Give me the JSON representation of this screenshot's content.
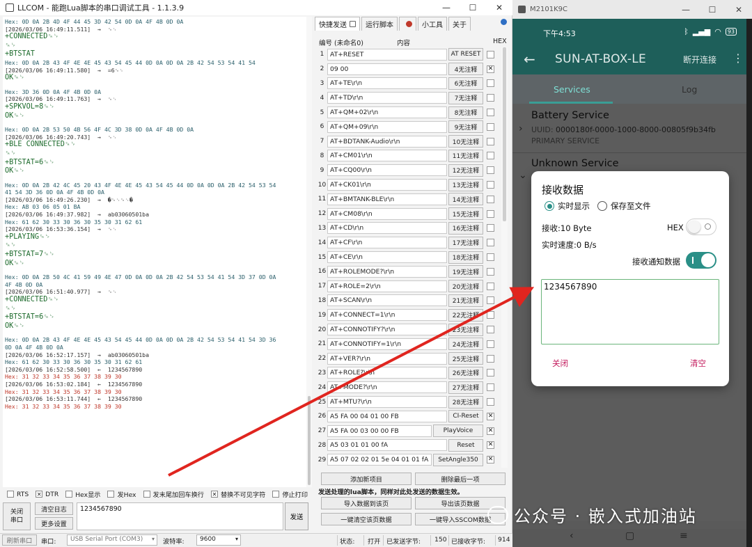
{
  "llcom": {
    "title": "LLCOM - 能跑Lua脚本的串口调试工具 - 1.1.3.9",
    "window_controls": {
      "minimize": "—",
      "maximize": "☐",
      "close": "✕"
    },
    "log": [
      {
        "k": "hex",
        "t": "Hex: 0D 0A 2B 4D 4F 44 45 3D 42 54 0D 0A 4F 4B 0D 0A"
      },
      {
        "k": "ts",
        "t": "[2026/03/06 16:49:11.511]  →  ␍␊"
      },
      {
        "k": "rx",
        "t": "+CONNECTED␍␊"
      },
      {
        "k": "rx",
        "t": "␍␊"
      },
      {
        "k": "rx",
        "t": "+BTSTAT"
      },
      {
        "k": "hex",
        "t": "Hex: 0D 0A 2B 43 4F 4E 4E 45 43 54 45 44 0D 0A 0D 0A 2B 42 54 53 54 41 54"
      },
      {
        "k": "ts",
        "t": "[2026/03/06 16:49:11.580]  →  =6␍␊"
      },
      {
        "k": "rx",
        "t": "OK␍␊"
      },
      {
        "k": "blank",
        "t": ""
      },
      {
        "k": "hex",
        "t": "Hex: 3D 36 0D 0A 4F 4B 0D 0A"
      },
      {
        "k": "ts",
        "t": "[2026/03/06 16:49:11.763]  →  ␍␊"
      },
      {
        "k": "rx",
        "t": "+SPKVOL=8␍␊"
      },
      {
        "k": "rx",
        "t": "OK␍␊"
      },
      {
        "k": "blank",
        "t": ""
      },
      {
        "k": "hex",
        "t": "Hex: 0D 0A 2B 53 50 4B 56 4F 4C 3D 38 0D 0A 4F 4B 0D 0A"
      },
      {
        "k": "ts",
        "t": "[2026/03/06 16:49:20.743]  →  ␍␊"
      },
      {
        "k": "rx",
        "t": "+BLE CONNECTED␍␊"
      },
      {
        "k": "rx",
        "t": "␍␊"
      },
      {
        "k": "rx",
        "t": "+BTSTAT=6␍␊"
      },
      {
        "k": "rx",
        "t": "OK␍␊"
      },
      {
        "k": "blank",
        "t": ""
      },
      {
        "k": "hex",
        "t": "Hex: 0D 0A 2B 42 4C 45 20 43 4F 4E 4E 45 43 54 45 44 0D 0A 0D 0A 2B 42 54 53 54"
      },
      {
        "k": "hex",
        "t": "41 54 3D 36 0D 0A 4F 4B 0D 0A"
      },
      {
        "k": "ts",
        "t": "[2026/03/06 16:49:26.230]  →  �␍␊␍␊�"
      },
      {
        "k": "hex",
        "t": "Hex: AB 03 06 05 01 BA"
      },
      {
        "k": "ts",
        "t": "[2026/03/06 16:49:37.982]  →  ab03060501ba"
      },
      {
        "k": "hex",
        "t": "Hex: 61 62 30 33 30 36 30 35 30 31 62 61"
      },
      {
        "k": "ts",
        "t": "[2026/03/06 16:53:36.154]  →  ␍␊"
      },
      {
        "k": "rx",
        "t": "+PLAYING␍␊"
      },
      {
        "k": "rx",
        "t": "␍␊"
      },
      {
        "k": "rx",
        "t": "+BTSTAT=7␍␊"
      },
      {
        "k": "rx",
        "t": "OK␍␊"
      },
      {
        "k": "blank",
        "t": ""
      },
      {
        "k": "hex",
        "t": "Hex: 0D 0A 2B 50 4C 41 59 49 4E 47 0D 0A 0D 0A 2B 42 54 53 54 41 54 3D 37 0D 0A"
      },
      {
        "k": "hex",
        "t": "4F 4B 0D 0A"
      },
      {
        "k": "ts",
        "t": "[2026/03/06 16:51:40.977]  →  ␍␊"
      },
      {
        "k": "rx",
        "t": "+CONNECTED␍␊"
      },
      {
        "k": "rx",
        "t": "␍␊"
      },
      {
        "k": "rx",
        "t": "+BTSTAT=6␍␊"
      },
      {
        "k": "rx",
        "t": "OK␍␊"
      },
      {
        "k": "blank",
        "t": ""
      },
      {
        "k": "hex",
        "t": "Hex: 0D 0A 2B 43 4F 4E 4E 45 43 54 45 44 0D 0A 0D 0A 2B 42 54 53 54 41 54 3D 36"
      },
      {
        "k": "hex",
        "t": "0D 0A 4F 4B 0D 0A"
      },
      {
        "k": "ts",
        "t": "[2026/03/06 16:52:17.157]  →  ab03060501ba"
      },
      {
        "k": "hex",
        "t": "Hex: 61 62 30 33 30 36 30 35 30 31 62 61"
      },
      {
        "k": "txts",
        "t": "[2026/03/06 16:52:58.500]  ←  1234567890"
      },
      {
        "k": "txhex",
        "t": "Hex: 31 32 33 34 35 36 37 38 39 30"
      },
      {
        "k": "txts",
        "t": "[2026/03/06 16:53:02.184]  ←  1234567890"
      },
      {
        "k": "txhex",
        "t": "Hex: 31 32 33 34 35 36 37 38 39 30"
      },
      {
        "k": "txts",
        "t": "[2026/03/06 16:53:11.744]  ←  1234567890"
      },
      {
        "k": "txhex",
        "t": "Hex: 31 32 33 34 35 36 37 38 39 30"
      }
    ],
    "tabs": [
      {
        "label": "快捷发送",
        "icon": "sheet-icon"
      },
      {
        "label": "运行脚本",
        "icon": ""
      },
      {
        "label": "",
        "icon": "lua-icon"
      },
      {
        "label": "小工具",
        "icon": ""
      },
      {
        "label": "关于",
        "icon": ""
      }
    ],
    "quick_send": {
      "header_name": "编号 (未命名0)",
      "header_content": "内容",
      "header_hex": "HEX",
      "rows": [
        {
          "num": "1",
          "cmd": "AT+RESET",
          "note": "AT RESET",
          "hex": false
        },
        {
          "num": "2",
          "cmd": "09 00",
          "note": "4无注释",
          "hex": true
        },
        {
          "num": "3",
          "cmd": "AT+TE\\r\\n",
          "note": "6无注释",
          "hex": false
        },
        {
          "num": "4",
          "cmd": "AT+TD\\r\\n",
          "note": "7无注释",
          "hex": false
        },
        {
          "num": "5",
          "cmd": "AT+QM+02\\r\\n",
          "note": "8无注释",
          "hex": false
        },
        {
          "num": "6",
          "cmd": "AT+QM+09\\r\\n",
          "note": "9无注释",
          "hex": false
        },
        {
          "num": "7",
          "cmd": "AT+BDTANK-Audio\\r\\n",
          "note": "10无注释",
          "hex": false
        },
        {
          "num": "8",
          "cmd": "AT+CM01\\r\\n",
          "note": "11无注释",
          "hex": false
        },
        {
          "num": "9",
          "cmd": "AT+CQ00\\r\\n",
          "note": "12无注释",
          "hex": false
        },
        {
          "num": "10",
          "cmd": "AT+CK01\\r\\n",
          "note": "13无注释",
          "hex": false
        },
        {
          "num": "11",
          "cmd": "AT+BMTANK-BLE\\r\\n",
          "note": "14无注释",
          "hex": false
        },
        {
          "num": "12",
          "cmd": "AT+CM08\\r\\n",
          "note": "15无注释",
          "hex": false
        },
        {
          "num": "13",
          "cmd": "AT+CD\\r\\n",
          "note": "16无注释",
          "hex": false
        },
        {
          "num": "14",
          "cmd": "AT+CF\\r\\n",
          "note": "17无注释",
          "hex": false
        },
        {
          "num": "15",
          "cmd": "AT+CE\\r\\n",
          "note": "18无注释",
          "hex": false
        },
        {
          "num": "16",
          "cmd": "AT+ROLEMODE?\\r\\n",
          "note": "19无注释",
          "hex": false
        },
        {
          "num": "17",
          "cmd": "AT+ROLE=2\\r\\n",
          "note": "20无注释",
          "hex": false
        },
        {
          "num": "18",
          "cmd": "AT+SCAN\\r\\n",
          "note": "21无注释",
          "hex": false
        },
        {
          "num": "19",
          "cmd": "AT+CONNECT=1\\r\\n",
          "note": "22无注释",
          "hex": false
        },
        {
          "num": "20",
          "cmd": "AT+CONNOTIFY?\\r\\n",
          "note": "23无注释",
          "hex": false
        },
        {
          "num": "21",
          "cmd": "AT+CONNOTIFY=1\\r\\n",
          "note": "24无注释",
          "hex": false
        },
        {
          "num": "22",
          "cmd": "AT+VER?\\r\\n",
          "note": "25无注释",
          "hex": false
        },
        {
          "num": "23",
          "cmd": "AT+ROLE?\\r\\n",
          "note": "26无注释",
          "hex": false
        },
        {
          "num": "24",
          "cmd": "AT+MODE?\\r\\n",
          "note": "27无注释",
          "hex": false
        },
        {
          "num": "25",
          "cmd": "AT+MTU?\\r\\n",
          "note": "28无注释",
          "hex": false
        },
        {
          "num": "26",
          "cmd": "A5 FA 00 04 01 00 FB",
          "note": "CI-Reset",
          "hex": true
        },
        {
          "num": "27",
          "cmd": "A5 FA 00 03 00 00 FB",
          "note": "PlayVoice",
          "hex": true
        },
        {
          "num": "28",
          "cmd": "A5 03 01 01 00 fA",
          "note": "Reset",
          "hex": true
        },
        {
          "num": "29",
          "cmd": "A5 07 02 02 01 5e 04 01 01 fA",
          "note": "SetAngle350",
          "hex": true
        }
      ]
    },
    "buttons": {
      "add_item": "添加新项目",
      "delete_last": "删除最后一项",
      "import_page": "导入数据到该页",
      "export_page": "导出该页数据",
      "clear_page": "一键清空该页数据",
      "import_sscom": "一键导入SSCOM数据"
    },
    "lua_note": "发送处理的lua脚本，同样对此处发送的数据生效。",
    "options": [
      {
        "label": "RTS",
        "checked": false
      },
      {
        "label": "DTR",
        "checked": true
      },
      {
        "label": "Hex显示",
        "checked": false
      },
      {
        "label": "发Hex",
        "checked": false
      },
      {
        "label": "发末尾加回车换行",
        "checked": false
      },
      {
        "label": "替换不可见字符",
        "checked": true
      },
      {
        "label": "停止打印",
        "checked": false
      }
    ],
    "left_buttons": {
      "close_port": "关闭\n串口",
      "clear_log": "清空日志",
      "more_settings": "更多设置"
    },
    "send_input": "1234567890",
    "send_button": "发送",
    "statusbar": {
      "refresh": "刷新串口",
      "port_label": "串口:",
      "port_value": "USB Serial Port (COM3)",
      "baud_label": "波特率:",
      "baud_value": "9600",
      "state_label": "状态:",
      "state_value": "打开",
      "sent_label": "已发送字节:",
      "sent_value": "150",
      "recv_label": "已接收字节:",
      "recv_value": "914"
    }
  },
  "phone": {
    "window_title": "M2101K9C",
    "window_controls": {
      "minimize": "—",
      "maximize": "☐",
      "close": "✕"
    },
    "status_time": "下午4:53",
    "battery": "93",
    "app_title": "SUN-AT-BOX-LE",
    "disconnect": "断开连接",
    "tabs": [
      "Services",
      "Log"
    ],
    "services": [
      {
        "name": "Battery Service",
        "uuid_label": "UUID:",
        "uuid": "0000180f-0000-1000-8000-00805f9b34fb",
        "type": "PRIMARY SERVICE"
      },
      {
        "name": "Unknown Service",
        "uuid_label": "",
        "uuid": "",
        "type": ""
      }
    ],
    "dialog": {
      "title": "接收数据",
      "radio_realtime": "实时显示",
      "radio_save": "保存至文件",
      "recv_label": "接收:10 Byte",
      "hex_label": "HEX",
      "speed_label": "实时速度:0 B/s",
      "notify_label": "接收通知数据",
      "received_text": "1234567890",
      "close": "关闭",
      "clear": "清空"
    }
  },
  "watermark": "公众号 · 嵌入式加油站",
  "colors": {
    "app_teal": "#1e5f5a",
    "accent_teal": "#2a8f87",
    "dialog_button_pink": "#c2185b",
    "arrow_red": "#e0251f",
    "rx_green": "#1d6b2c",
    "tx_red": "#b03030"
  }
}
